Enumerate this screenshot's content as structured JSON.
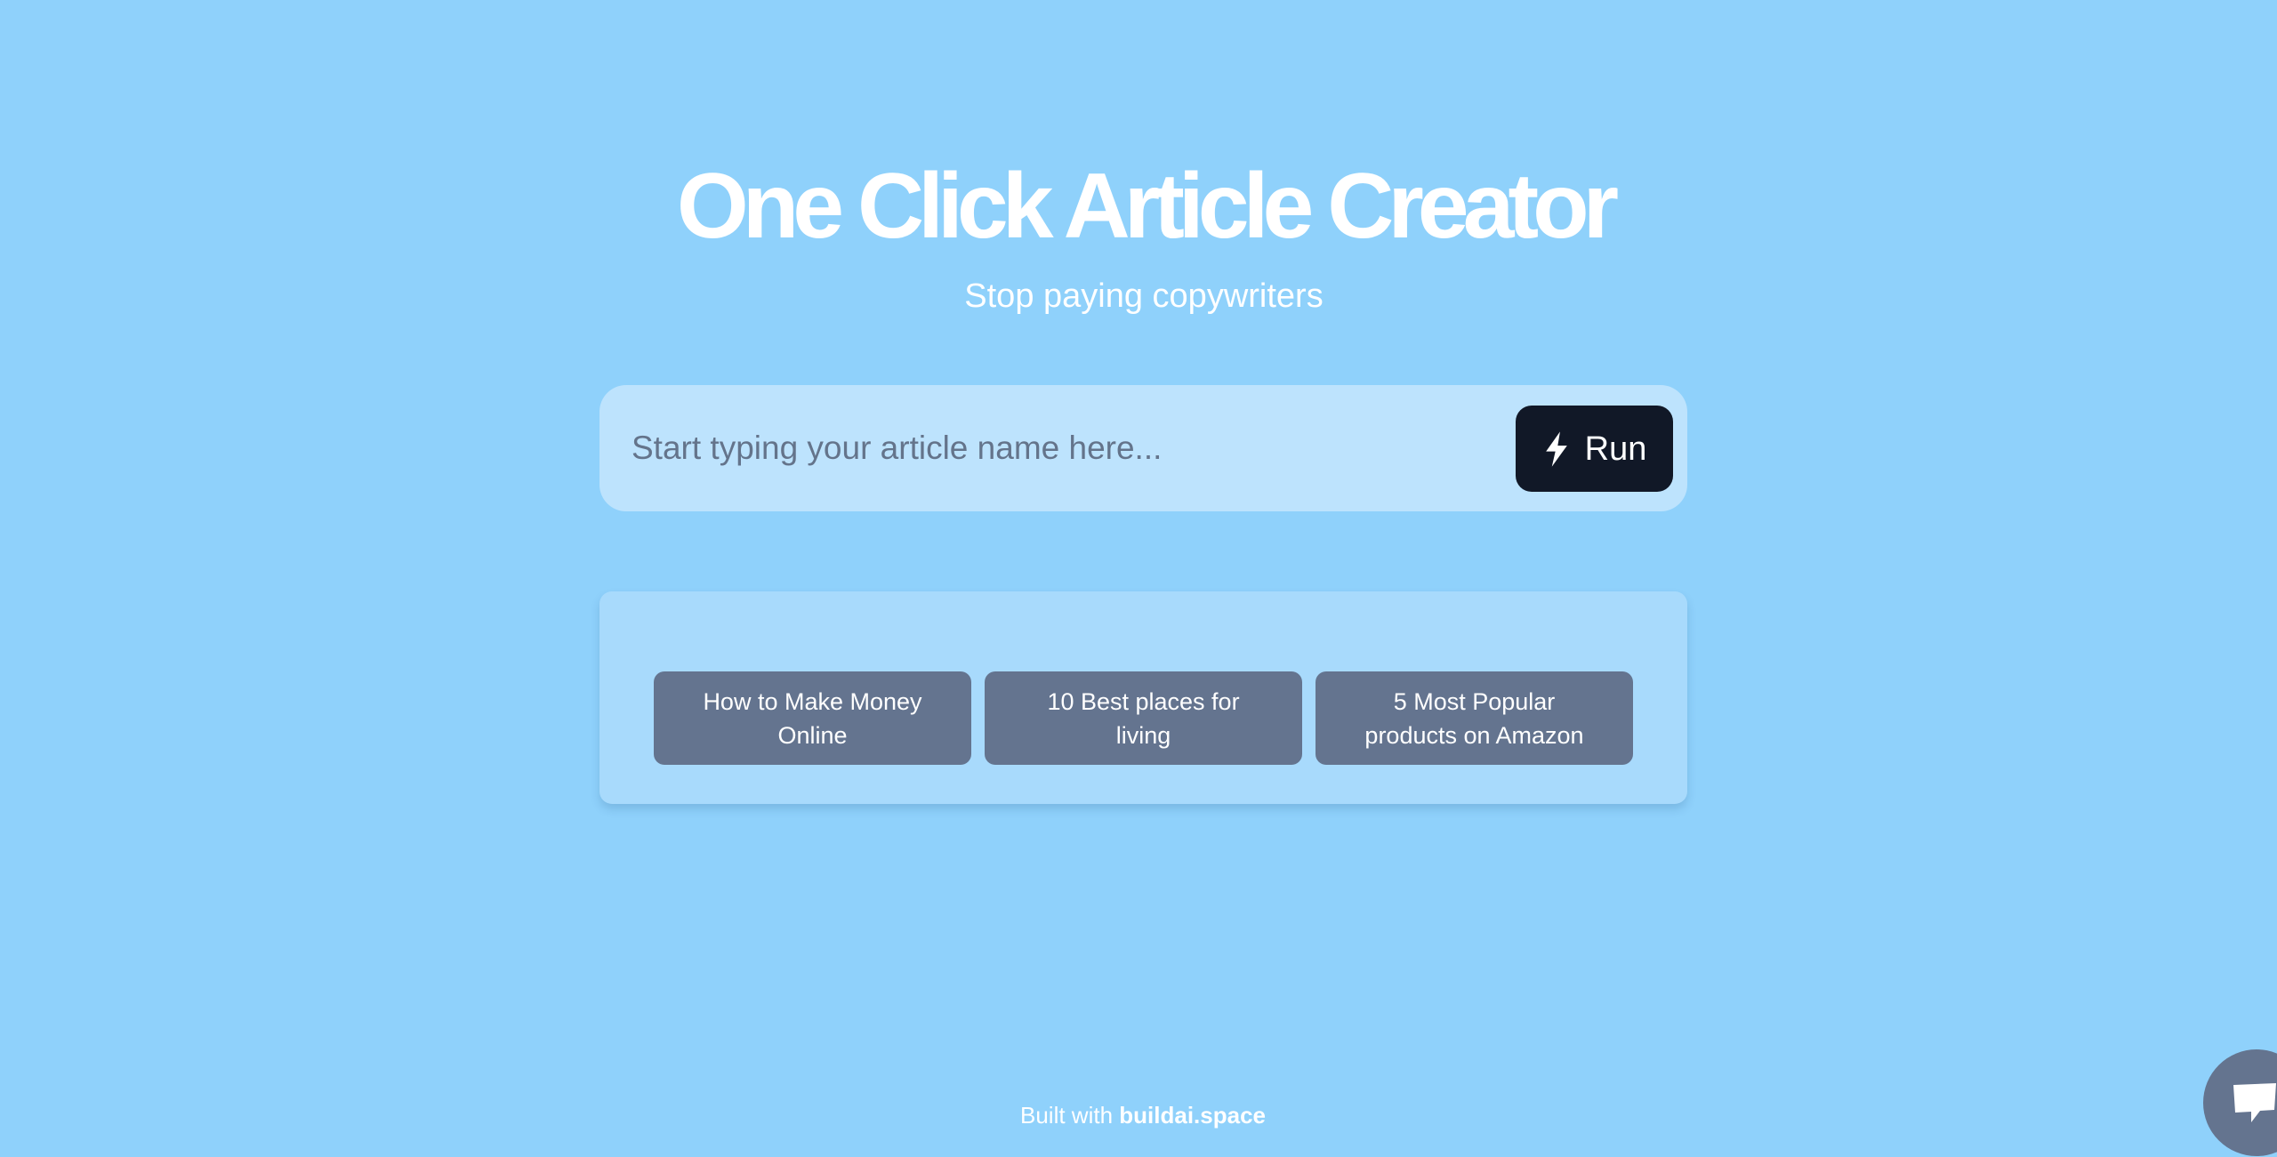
{
  "hero": {
    "title": "One Click Article Creator",
    "subtitle": "Stop paying copywriters"
  },
  "search": {
    "placeholder": "Start typing your article name here...",
    "value": "",
    "run_label": "Run",
    "run_icon": "lightning-bolt-icon"
  },
  "examples": [
    {
      "label": "How to Make Money Online"
    },
    {
      "label": "10 Best places for living"
    },
    {
      "label": "5 Most Popular products on Amazon"
    }
  ],
  "footer": {
    "prefix": "Built with",
    "brand": "buildai.space"
  },
  "chat": {
    "icon": "chat-bubble-icon"
  },
  "colors": {
    "background": "#8fd1fb",
    "search_bar": "#bde3fd",
    "run_button": "#111827",
    "examples_card": "#a8dafc",
    "example_button": "#64748f"
  }
}
